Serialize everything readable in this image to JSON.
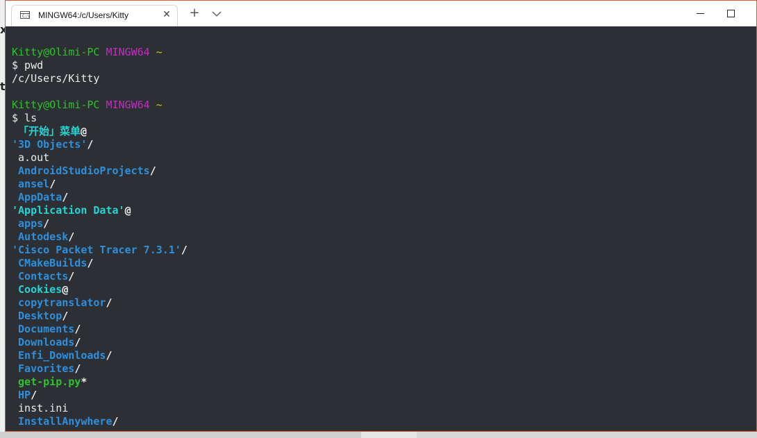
{
  "window": {
    "tab_title": "MINGW64:/c/Users/Kitty",
    "tab_close": "✕",
    "new_tab": "+",
    "icon_names": [
      "terminal-icon",
      "close-icon",
      "plus-icon",
      "chevron-down-icon",
      "minimize-icon",
      "maximize-icon"
    ]
  },
  "terminal": {
    "prompt1": {
      "user": "Kitty@Olimi-PC",
      "shell": "MINGW64",
      "dir": "~"
    },
    "cmd1": "$ pwd",
    "out1": "/c/Users/Kitty",
    "prompt2": {
      "user": "Kitty@Olimi-PC",
      "shell": "MINGW64",
      "dir": "~"
    },
    "cmd2": "$ ls",
    "entries": [
      {
        "pre": " ",
        "name": "「开始」菜单",
        "suffix": "@",
        "kind": "cyan"
      },
      {
        "pre": "",
        "name": "'3D Objects'",
        "suffix": "/",
        "kind": "blue"
      },
      {
        "pre": " ",
        "name": "a.out",
        "suffix": "",
        "kind": "white"
      },
      {
        "pre": " ",
        "name": "AndroidStudioProjects",
        "suffix": "/",
        "kind": "blue"
      },
      {
        "pre": " ",
        "name": "ansel",
        "suffix": "/",
        "kind": "blue"
      },
      {
        "pre": " ",
        "name": "AppData",
        "suffix": "/",
        "kind": "blue"
      },
      {
        "pre": "",
        "name": "'Application Data'",
        "suffix": "@",
        "kind": "cyan"
      },
      {
        "pre": " ",
        "name": "apps",
        "suffix": "/",
        "kind": "blue"
      },
      {
        "pre": " ",
        "name": "Autodesk",
        "suffix": "/",
        "kind": "blue"
      },
      {
        "pre": "",
        "name": "'Cisco Packet Tracer 7.3.1'",
        "suffix": "/",
        "kind": "blue"
      },
      {
        "pre": " ",
        "name": "CMakeBuilds",
        "suffix": "/",
        "kind": "blue"
      },
      {
        "pre": " ",
        "name": "Contacts",
        "suffix": "/",
        "kind": "blue"
      },
      {
        "pre": " ",
        "name": "Cookies",
        "suffix": "@",
        "kind": "cyan"
      },
      {
        "pre": " ",
        "name": "copytranslator",
        "suffix": "/",
        "kind": "blue"
      },
      {
        "pre": " ",
        "name": "Desktop",
        "suffix": "/",
        "kind": "blue"
      },
      {
        "pre": " ",
        "name": "Documents",
        "suffix": "/",
        "kind": "blue"
      },
      {
        "pre": " ",
        "name": "Downloads",
        "suffix": "/",
        "kind": "blue"
      },
      {
        "pre": " ",
        "name": "Enfi_Downloads",
        "suffix": "/",
        "kind": "blue"
      },
      {
        "pre": " ",
        "name": "Favorites",
        "suffix": "/",
        "kind": "blue"
      },
      {
        "pre": " ",
        "name": "get-pip.py",
        "suffix": "*",
        "kind": "exe"
      },
      {
        "pre": " ",
        "name": "HP",
        "suffix": "/",
        "kind": "blue"
      },
      {
        "pre": " ",
        "name": "inst.ini",
        "suffix": "",
        "kind": "white"
      },
      {
        "pre": " ",
        "name": "InstallAnywhere",
        "suffix": "/",
        "kind": "blue"
      }
    ]
  },
  "background": {
    "char1": "x",
    "char2": "t"
  },
  "colors": {
    "terminal_bg": "#2c2f33",
    "prompt_user": "#2ec22e",
    "prompt_shell": "#c12fc1",
    "prompt_dir": "#c9c22a",
    "directory": "#2e8fdc",
    "symlink": "#26d4d4",
    "executable": "#2ec22e",
    "window_border": "#e05a3a"
  }
}
